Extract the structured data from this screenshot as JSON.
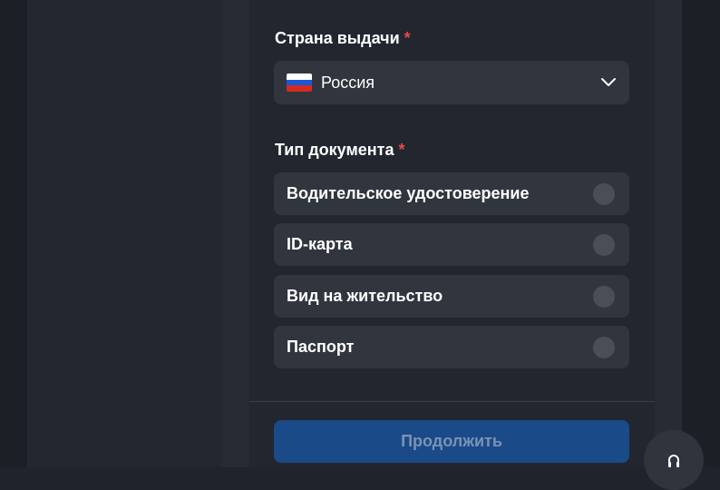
{
  "form": {
    "country": {
      "label": "Страна выдачи",
      "required_mark": "*",
      "selected": "Россия",
      "flag_icon": "russia-flag-icon"
    },
    "doc_type": {
      "label": "Тип документа",
      "required_mark": "*",
      "options": [
        {
          "label": "Водительское удостоверение",
          "selected": false
        },
        {
          "label": "ID-карта",
          "selected": false
        },
        {
          "label": "Вид на жительство",
          "selected": false
        },
        {
          "label": "Паспорт",
          "selected": false
        }
      ]
    },
    "continue_label": "Продолжить"
  },
  "colors": {
    "accent": "#1a4a87",
    "required": "#e5484d",
    "field_bg": "#31353e"
  },
  "icons": {
    "dropdown": "chevron-down-icon",
    "support": "headset-icon"
  }
}
